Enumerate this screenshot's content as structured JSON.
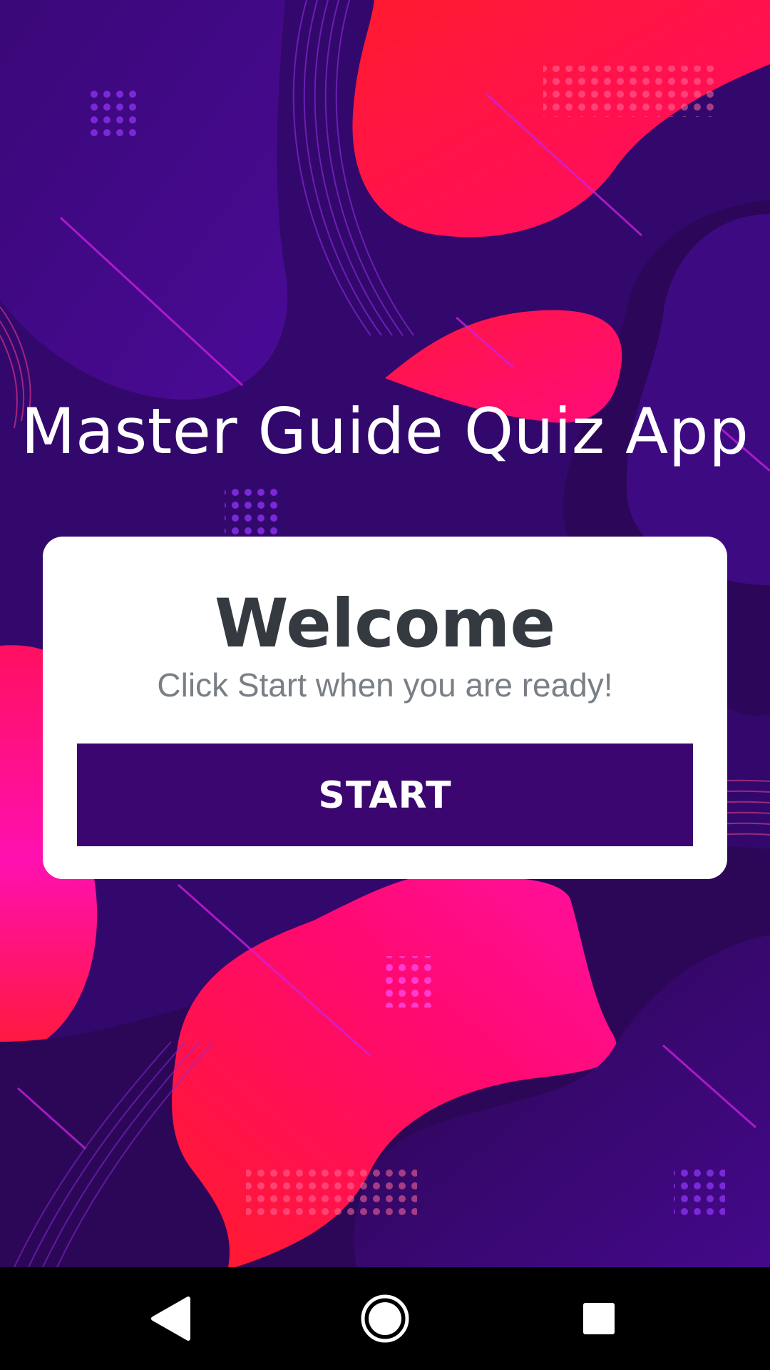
{
  "app": {
    "title": "Master Guide Quiz App"
  },
  "welcome_card": {
    "title": "Welcome",
    "subtitle": "Click Start when you are ready!",
    "start_label": "START"
  },
  "nav_bar": {
    "back_icon": "back-triangle-icon",
    "home_icon": "home-circle-icon",
    "recents_icon": "recents-square-icon"
  },
  "colors": {
    "background": "#32086b",
    "accent_red": "#ff0a3c",
    "accent_pink": "#ff0a9c",
    "button": "#3b0670",
    "card": "#ffffff",
    "title_text": "#353a40",
    "subtitle_text": "#7a7f86"
  }
}
